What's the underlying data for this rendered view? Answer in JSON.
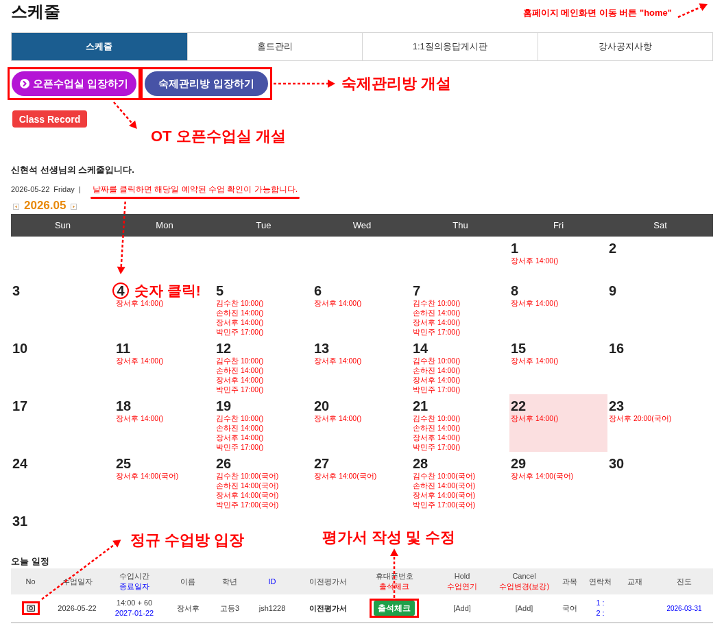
{
  "header": {
    "title": "스케줄",
    "callout": "홈페이지 메인화면 이동 버튼 \"home\""
  },
  "tabs": [
    {
      "label": "스케줄",
      "selected": true
    },
    {
      "label": "홀드관리",
      "selected": false
    },
    {
      "label": "1:1질의응답게시판",
      "selected": false
    },
    {
      "label": "강사공지사항",
      "selected": false
    }
  ],
  "actions": {
    "buttons": [
      {
        "kind": "open_class",
        "label": "오픈수업실 입장하기",
        "callout": "OT 오픈수업실 개설"
      },
      {
        "kind": "homework",
        "label": "숙제관리방 입장하기",
        "callout": "숙제관리방 개설"
      }
    ],
    "record_button": "Class Record"
  },
  "schedule": {
    "heading": "신현석 선생님의 스케줄입니다.",
    "date": "2026-05-22",
    "weekday": "Friday",
    "separator": "|",
    "hint": "날짜를 클릭하면 해당일 예약된 수업 확인이 가능합니다.",
    "month": "2026.05",
    "weekdays": [
      "Sun",
      "Mon",
      "Tue",
      "Wed",
      "Thu",
      "Fri",
      "Sat"
    ],
    "weeks": [
      [
        {
          "day": "1",
          "selected": false,
          "entries": [
            "장서후 14:00()"
          ]
        },
        {
          "day": "2",
          "selected": false
        }
      ],
      [
        {
          "day": "3",
          "selected": false
        },
        {
          "day": "4",
          "selected": false,
          "callout": "숫자 클릭!",
          "entries": [
            "장서후 14:00()"
          ]
        },
        {
          "day": "5",
          "selected": false,
          "entries": [
            "김수찬 10:00()",
            "손하진 14:00()",
            "장서후 14:00()",
            "박민주 17:00()"
          ]
        },
        {
          "day": "6",
          "selected": false,
          "entries": [
            "장서후 14:00()"
          ]
        },
        {
          "day": "7",
          "selected": false,
          "entries": [
            "김수찬 10:00()",
            "손하진 14:00()",
            "장서후 14:00()",
            "박민주 17:00()"
          ]
        },
        {
          "day": "8",
          "selected": false,
          "entries": [
            "장서후 14:00()"
          ]
        },
        {
          "day": "9",
          "selected": false
        }
      ],
      [
        {
          "day": "10",
          "selected": false
        },
        {
          "day": "11",
          "selected": false,
          "entries": [
            "장서후 14:00()"
          ]
        },
        {
          "day": "12",
          "selected": false,
          "entries": [
            "김수찬 10:00()",
            "손하진 14:00()",
            "장서후 14:00()",
            "박민주 17:00()"
          ]
        },
        {
          "day": "13",
          "selected": false,
          "entries": [
            "장서후 14:00()"
          ]
        },
        {
          "day": "14",
          "selected": false,
          "entries": [
            "김수찬 10:00()",
            "손하진 14:00()",
            "장서후 14:00()",
            "박민주 17:00()"
          ]
        },
        {
          "day": "15",
          "selected": false,
          "entries": [
            "장서후 14:00()"
          ]
        },
        {
          "day": "16",
          "selected": false
        }
      ],
      [
        {
          "day": "17",
          "selected": false
        },
        {
          "day": "18",
          "selected": false,
          "entries": [
            "장서후 14:00()"
          ]
        },
        {
          "day": "19",
          "selected": false,
          "entries": [
            "김수찬 10:00()",
            "손하진 14:00()",
            "장서후 14:00()",
            "박민주 17:00()"
          ]
        },
        {
          "day": "20",
          "selected": false,
          "entries": [
            "장서후 14:00()"
          ]
        },
        {
          "day": "21",
          "selected": false,
          "entries": [
            "김수찬 10:00()",
            "손하진 14:00()",
            "장서후 14:00()",
            "박민주 17:00()"
          ]
        },
        {
          "day": "22",
          "selected": true,
          "entries": [
            "장서후 14:00()"
          ]
        },
        {
          "day": "23",
          "selected": false,
          "entries": [
            "장서후 20:00(국어)"
          ]
        }
      ],
      [
        {
          "day": "24",
          "selected": false
        },
        {
          "day": "25",
          "selected": false,
          "entries": [
            "장서후 14:00(국어)"
          ]
        },
        {
          "day": "26",
          "selected": false,
          "entries": [
            "김수찬 10:00(국어)",
            "손하진 14:00(국어)",
            "장서후 14:00(국어)",
            "박민주 17:00(국어)"
          ]
        },
        {
          "day": "27",
          "selected": false,
          "entries": [
            "장서후 14:00(국어)"
          ]
        },
        {
          "day": "28",
          "selected": false,
          "entries": [
            "김수찬 10:00(국어)",
            "손하진 14:00(국어)",
            "장서후 14:00(국어)",
            "박민주 17:00(국어)"
          ]
        },
        {
          "day": "29",
          "selected": false,
          "entries": [
            "장서후 14:00(국어)"
          ]
        },
        {
          "day": "30",
          "selected": false
        }
      ],
      [
        {
          "day": "31",
          "selected": false
        }
      ]
    ]
  },
  "today": {
    "annotations": [
      {
        "kind": "room",
        "text": "정규 수업방 입장"
      },
      {
        "kind": "check_in",
        "text": "평가서 작성 및 수정"
      }
    ],
    "title": "오늘 일정",
    "columns": [
      {
        "label": "No",
        "kind": "plain"
      },
      {
        "label": "수업일자",
        "kind": "plain"
      },
      {
        "label": "수업시간",
        "kind": "plain",
        "sublabel": {
          "text": "종료일자",
          "kind": "link"
        }
      },
      {
        "label": "이름",
        "kind": "plain"
      },
      {
        "label": "학년",
        "kind": "plain"
      },
      {
        "label": "ID",
        "kind": "link"
      },
      {
        "label": "이전평가서",
        "kind": "plain"
      },
      {
        "label": "휴대폰번호",
        "kind": "plain",
        "sublabel": {
          "text": "출석체크",
          "kind": "alert"
        }
      },
      {
        "label": "Hold",
        "kind": "plain",
        "sublabel": {
          "text": "수업연기",
          "kind": "alert"
        }
      },
      {
        "label": "Cancel",
        "kind": "plain",
        "sublabel": {
          "text": "수업변경(보강)",
          "kind": "alert"
        }
      },
      {
        "label": "과목",
        "kind": "plain"
      },
      {
        "label": "연락처",
        "kind": "plain"
      },
      {
        "label": "교재",
        "kind": "plain"
      },
      {
        "label": "진도",
        "kind": "plain"
      }
    ],
    "rows": [
      {
        "cells": [
          {
            "kind": "room_icon"
          },
          {
            "kind": "text",
            "text": "2026-05-22"
          },
          {
            "kind": "stack",
            "lines": [
              {
                "text": "14:00 + 60",
                "kind": "plain"
              },
              {
                "text": "2027-01-22",
                "kind": "link"
              }
            ]
          },
          {
            "kind": "text",
            "text": "장서후"
          },
          {
            "kind": "text",
            "text": "고등3"
          },
          {
            "kind": "text",
            "text": "jsh1228"
          },
          {
            "kind": "bold",
            "text": "이전평가서"
          },
          {
            "kind": "button",
            "text": "출석체크"
          },
          {
            "kind": "action",
            "text": "[Add]"
          },
          {
            "kind": "action",
            "text": "[Add]"
          },
          {
            "kind": "text",
            "text": "국어"
          },
          {
            "kind": "stack",
            "lines": [
              {
                "text": "1 :",
                "kind": "link"
              },
              {
                "text": "2 :",
                "kind": "link"
              }
            ]
          },
          {
            "kind": "blank"
          },
          {
            "kind": "link",
            "text": "2026-03-31"
          }
        ]
      }
    ]
  }
}
